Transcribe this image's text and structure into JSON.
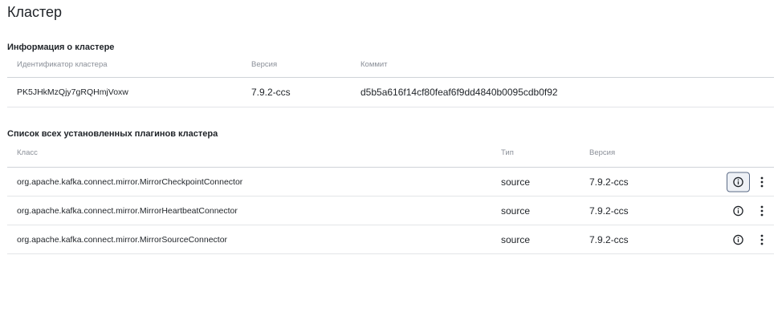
{
  "page": {
    "title": "Кластер"
  },
  "cluster_info": {
    "title": "Информация о кластере",
    "columns": {
      "id": "Идентификатор кластера",
      "version": "Версия",
      "commit": "Коммит"
    },
    "row": {
      "id": "PK5JHkMzQjy7gRQHmjVoxw",
      "version": "7.9.2-ccs",
      "commit": "d5b5a616f14cf80feaf6f9dd4840b0095cdb0f92"
    }
  },
  "plugins": {
    "title": "Список всех установленных плагинов кластера",
    "columns": {
      "class": "Класс",
      "type": "Тип",
      "version": "Версия"
    },
    "rows": [
      {
        "class": "org.apache.kafka.connect.mirror.MirrorCheckpointConnector",
        "type": "source",
        "version": "7.9.2-ccs",
        "info_active": true
      },
      {
        "class": "org.apache.kafka.connect.mirror.MirrorHeartbeatConnector",
        "type": "source",
        "version": "7.9.2-ccs",
        "info_active": false
      },
      {
        "class": "org.apache.kafka.connect.mirror.MirrorSourceConnector",
        "type": "source",
        "version": "7.9.2-ccs",
        "info_active": false
      }
    ]
  },
  "icons": {
    "info": "info-icon",
    "more": "more-vertical-icon"
  },
  "colors": {
    "text": "#1f2328",
    "muted": "#8a8f98",
    "divider": "#e3e5e8",
    "active_border": "#5b6b86"
  }
}
